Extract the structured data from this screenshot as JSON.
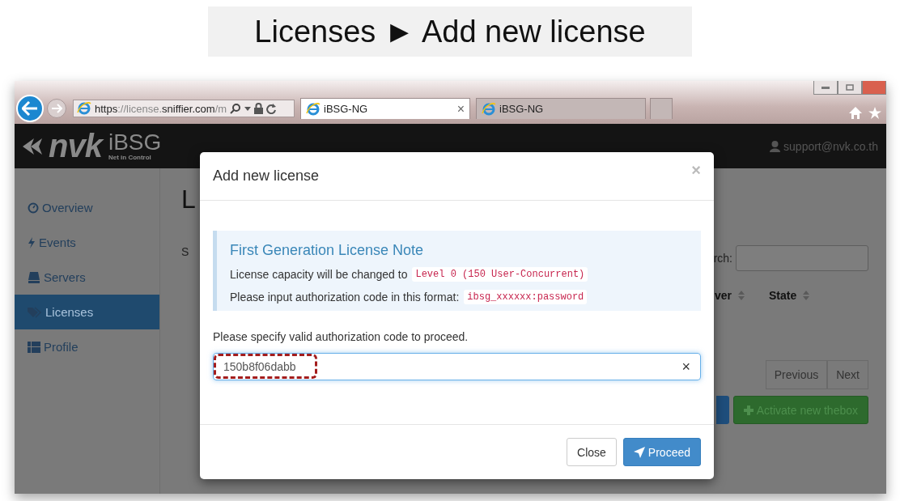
{
  "slide_title": "Licenses ► Add new license",
  "browser": {
    "address": "**https**://license.**sniffier.com**/m",
    "tabs": [
      {
        "label": "iBSG-NG",
        "close": "×",
        "selected": true
      },
      {
        "label": "iBSG-NG",
        "selected": false
      }
    ]
  },
  "app": {
    "logo": "nvk",
    "product": "iBSG",
    "tagline": "Net in Control",
    "user": "support@nvk.co.th",
    "sidebar": [
      {
        "label": "Overview",
        "selected": false
      },
      {
        "label": "Events",
        "selected": false
      },
      {
        "label": "Servers",
        "selected": false
      },
      {
        "label": "Licenses",
        "selected": true
      },
      {
        "label": "Profile",
        "selected": false
      }
    ],
    "page_heading": "L",
    "show_label": "S",
    "search_label": "rch:",
    "table_columns": [
      "ver",
      "State"
    ],
    "pagination": [
      "Previous",
      "Next"
    ],
    "activate_button": "Activate new thebox"
  },
  "modal": {
    "title": "Add new license",
    "close": "×",
    "note": {
      "title": "First Generation License Note",
      "lines": [
        {
          "text": "License capacity will be changed to",
          "code": "Level 0 (150 User-Concurrent)"
        },
        {
          "text": "Please input authorization code in this format:",
          "code": "ibsg_xxxxxx:password"
        }
      ]
    },
    "prompt": "Please specify valid authorization code to proceed.",
    "code_field": {
      "value": "150b8f06dabb",
      "clear": "×",
      "highlighted": true
    },
    "buttons": [
      {
        "label": "Close",
        "kind": "default"
      },
      {
        "label": "Proceed",
        "kind": "primary"
      }
    ]
  }
}
